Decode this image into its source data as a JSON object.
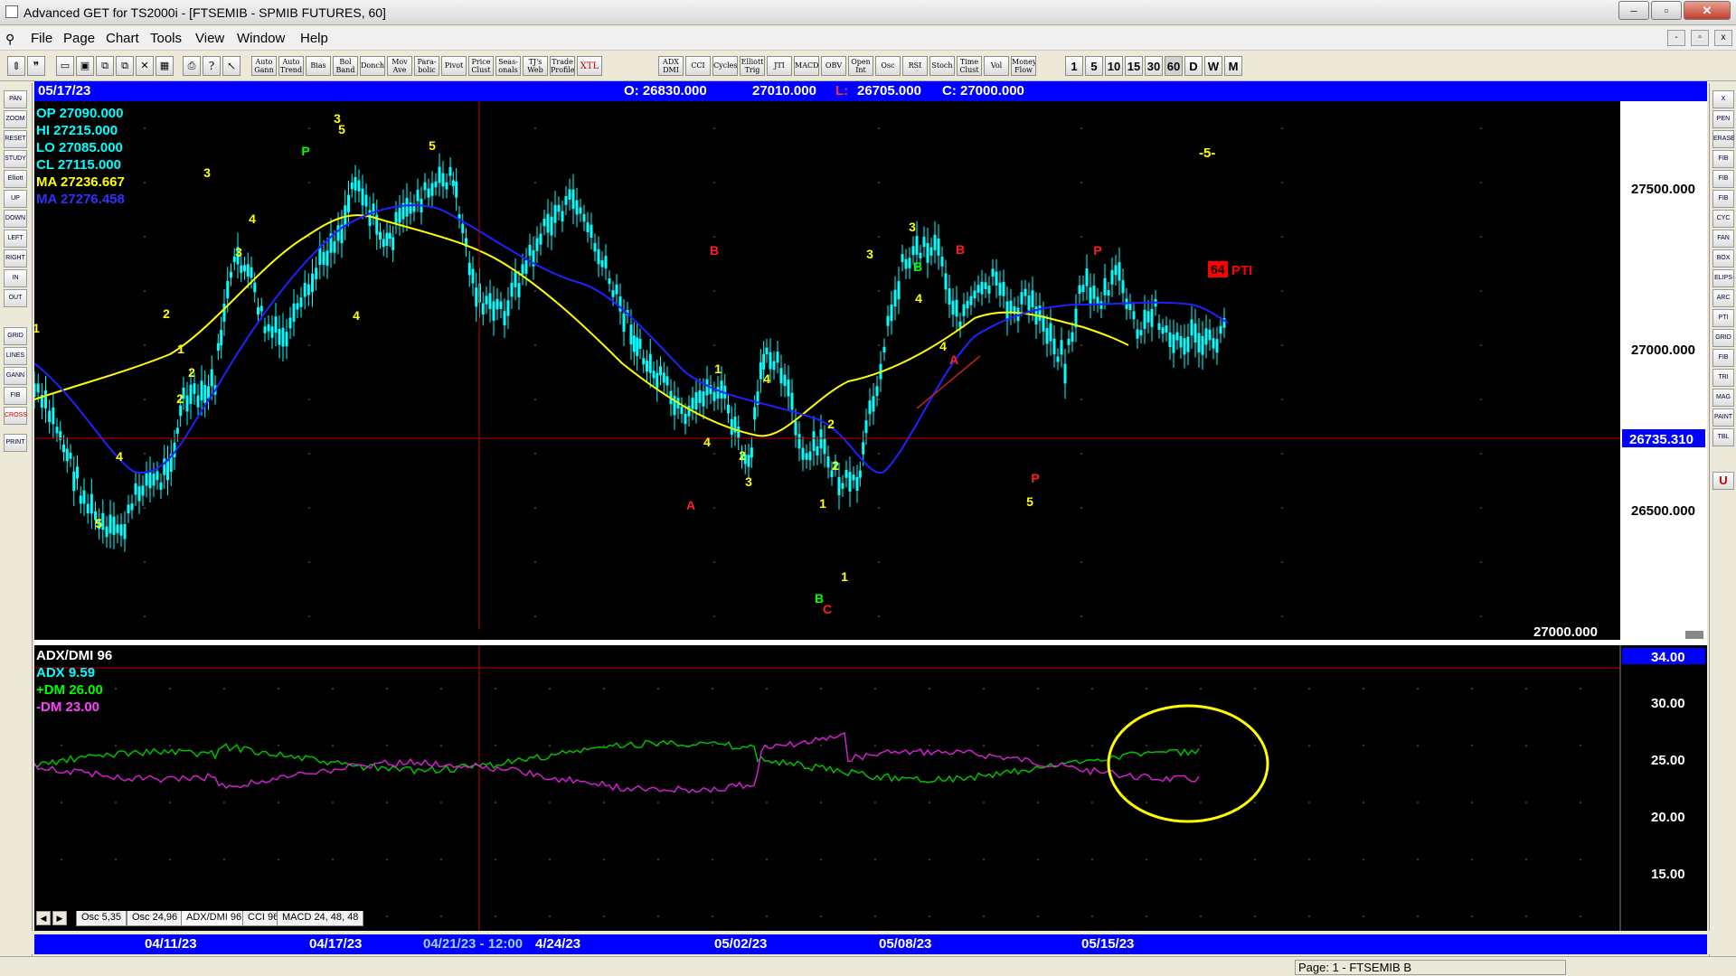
{
  "window": {
    "title": "Advanced GET for TS2000i - [FTSEMIB - SPMIB FUTURES, 60]",
    "btn_min": "–",
    "btn_max": "▫",
    "btn_close": "✕"
  },
  "menu": {
    "items": [
      "File",
      "Page",
      "Chart",
      "Tools",
      "View",
      "Window",
      "Help"
    ],
    "mdi": [
      "-",
      "▫",
      "x"
    ]
  },
  "toolbar": {
    "study_buttons": [
      "Auto Gann",
      "Auto Trend",
      "Bias",
      "Bol Band",
      "Donch",
      "Mov Ave",
      "Para- bolic",
      "Pivot",
      "Price Clust",
      "Seas- onals",
      "TJ's Web",
      "Trade Profile",
      "XTL",
      "ADX DMI",
      "CCI",
      "Cycles",
      "Elliott Trig",
      "JTI",
      "MACD",
      "OBV",
      "Open Int",
      "Osc",
      "RSI",
      "Stoch",
      "Time Clust",
      "Vol",
      "Money Flow"
    ],
    "timeframes": [
      "1",
      "5",
      "10",
      "15",
      "30",
      "60",
      "D",
      "W",
      "M"
    ]
  },
  "left_tools": [
    "PAN",
    "ZOOM",
    "RESET",
    "STUDY",
    "Elliott",
    "UP",
    "DOWN",
    "LEFT",
    "RIGHT",
    "IN",
    "OUT",
    "GRID",
    "LINES",
    "GANN",
    "FIB",
    "CROSS",
    "PRINT"
  ],
  "right_tools": [
    "X",
    "PEN",
    "ERASE",
    "FIB RET",
    "FIB EXT",
    "FIB TIME",
    "CYC",
    "FAN",
    "BOX",
    "ELIPS",
    "ARC",
    "PTI",
    "GRID",
    "FIB BOX",
    "TRI",
    "MAG",
    "PAINT",
    "TBL",
    "U"
  ],
  "infobar": {
    "date": "05/17/23",
    "open": "O: 26830.000",
    "high": "27010.000",
    "low_label": "L:",
    "low": "26705.000",
    "close": "C: 27000.000"
  },
  "legend": {
    "op": "OP 27090.000",
    "hi": "HI 27215.000",
    "lo": "LO 27085.000",
    "cl": "CL 27115.000",
    "ma1": "MA 27236.667",
    "ma2": "MA 27276.458",
    "colors": {
      "ohlc": "#00ffff",
      "ma1": "#ffff00",
      "ma2": "#3030ff"
    }
  },
  "price_axis": {
    "labels": [
      "27500.000",
      "27000.000",
      "26500.000"
    ],
    "cursor_price": "26735.310",
    "bottom_label": "27000.000"
  },
  "chart_annotations": {
    "wave5_label": "-5-",
    "pti_box": "64",
    "pti_text": "PTI"
  },
  "wave_labels": {
    "yellow": [
      "1",
      "2",
      "3",
      "4",
      "5",
      "1",
      "2",
      "2",
      "3",
      "4",
      "4",
      "5",
      "3",
      "5",
      "4",
      "1",
      "2",
      "4",
      "3",
      "1",
      "2",
      "1",
      "2",
      "3",
      "3",
      "4",
      "4",
      "5"
    ],
    "green": [
      "P",
      "B",
      "B"
    ],
    "red": [
      "B",
      "A",
      "C",
      "A",
      "B",
      "P",
      "P"
    ]
  },
  "indicator": {
    "title": "ADX/DMI 96",
    "adx": "ADX 9.59",
    "plus_dm": "+DM 26.00",
    "minus_dm": "-DM 23.00",
    "axis_labels": [
      "34.00",
      "30.00",
      "25.00",
      "20.00",
      "15.00"
    ],
    "colors": {
      "plus": "#00c000",
      "minus": "#d020d0",
      "adx": "#00ffff"
    }
  },
  "tabs": {
    "items": [
      "Osc 5,35",
      "Osc 24,96",
      "ADX/DMI 96",
      "CCI 96",
      "MACD 24, 48, 48"
    ],
    "prev": "◀",
    "next": "▶"
  },
  "date_axis": {
    "labels": [
      "04/11/23",
      "04/17/23",
      "04/21/23 - 12:00",
      "4/24/23",
      "05/02/23",
      "05/08/23",
      "05/15/23"
    ]
  },
  "status": {
    "page": "Page: 1 - FTSEMIB B"
  }
}
